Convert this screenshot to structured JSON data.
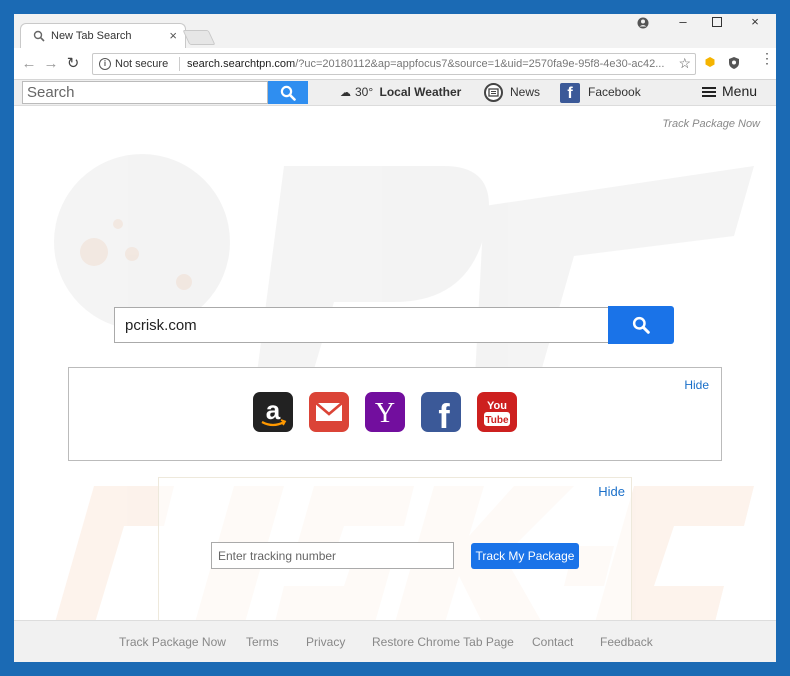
{
  "browser": {
    "tab_title": "New Tab Search",
    "security_label": "Not secure",
    "url_host": "search.searchtpn.com",
    "url_rest": "/?uc=20180112&ap=appfocus7&source=1&uid=2570fa9e-95f8-4e30-ac42..."
  },
  "sitebar": {
    "search_placeholder": "Search",
    "weather": "30°",
    "weather_label": "Local Weather",
    "news_label": "News",
    "facebook_label": "Facebook",
    "menu_label": "Menu"
  },
  "page": {
    "track_link": "Track Package Now",
    "main_search_value": "pcrisk.com",
    "shortcuts_hide": "Hide",
    "shortcuts": [
      "Amazon",
      "Gmail",
      "Yahoo",
      "Facebook",
      "YouTube"
    ],
    "tracker_hide": "Hide",
    "tracking_placeholder": "Enter tracking number",
    "track_button": "Track My Package"
  },
  "footer": {
    "links": [
      "Track Package Now",
      "Terms",
      "Privacy",
      "Restore Chrome Tab Page",
      "Contact",
      "Feedback"
    ]
  },
  "colors": {
    "accent": "#1a73e8",
    "frame": "#1b6ab4"
  }
}
